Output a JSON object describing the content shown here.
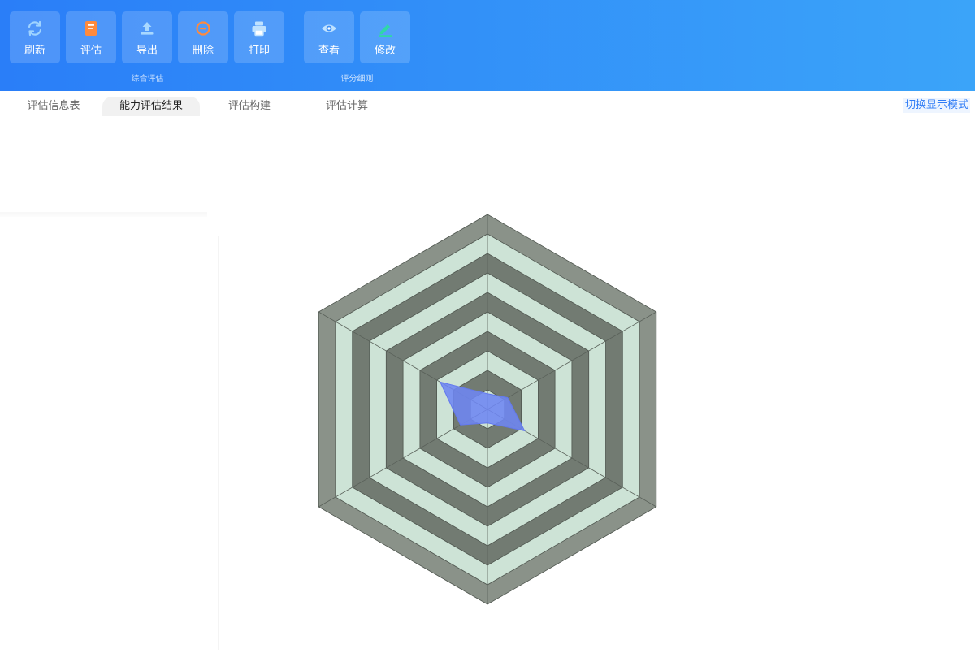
{
  "toolbar": {
    "buttons": [
      {
        "id": "refresh",
        "label": "刷新",
        "icon": "refresh-icon",
        "icon_color": "#9fd3ff"
      },
      {
        "id": "evaluate",
        "label": "评估",
        "icon": "document-icon",
        "icon_color": "#ff8a3d"
      },
      {
        "id": "export",
        "label": "导出",
        "icon": "upload-icon",
        "icon_color": "#a8d8ff"
      },
      {
        "id": "delete",
        "label": "删除",
        "icon": "minus-circle-icon",
        "icon_color": "#ff8a3d"
      },
      {
        "id": "print",
        "label": "打印",
        "icon": "printer-icon",
        "icon_color": "#bfe2ff"
      },
      {
        "id": "view",
        "label": "查看",
        "icon": "eye-icon",
        "icon_color": "#bfe2ff"
      },
      {
        "id": "edit",
        "label": "修改",
        "icon": "pencil-icon",
        "icon_color": "#2fd7a8"
      }
    ],
    "groups": [
      {
        "label": "综合评估"
      },
      {
        "label": "评分细则"
      }
    ]
  },
  "tabs": [
    {
      "label": "评估信息表",
      "active": false
    },
    {
      "label": "能力评估结果",
      "active": true
    },
    {
      "label": "评估构建",
      "active": false
    },
    {
      "label": "评估计算",
      "active": false
    }
  ],
  "switch_mode_label": "切换显示模式",
  "colors": {
    "ribbon_start": "#2a7ef8",
    "ribbon_end": "#3ba4f9",
    "ring_dark": "#727b72",
    "ring_light": "#cde3d6",
    "outer_ring": "#8a9289",
    "series_fill": "#6e86f2",
    "series_stroke": "#6278ee"
  },
  "chart_data": {
    "type": "radar",
    "title": "",
    "indicators_count": 6,
    "rings": 10,
    "max": 100,
    "series": [
      {
        "values": [
          8,
          12,
          22,
          7,
          16,
          28
        ]
      }
    ]
  }
}
